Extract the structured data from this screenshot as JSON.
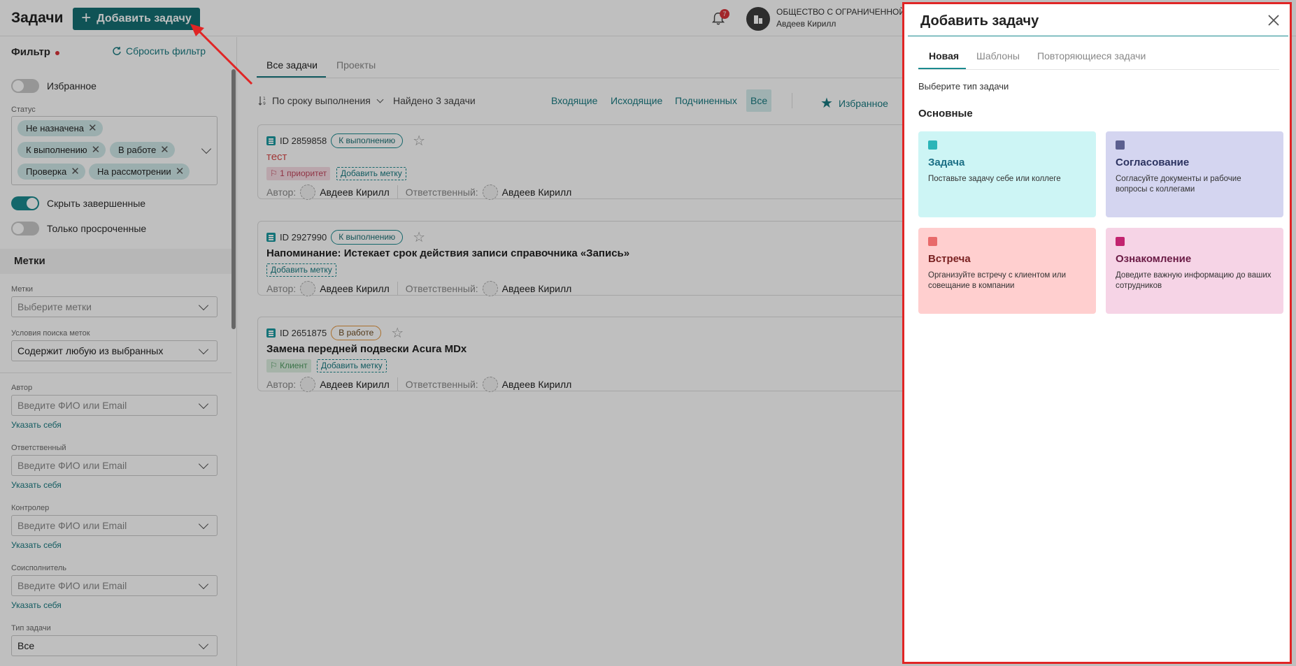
{
  "header": {
    "page_title": "Задачи",
    "add_button_label": "Добавить задачу",
    "notifications_count": "7",
    "org_name": "ОБЩЕСТВО С ОГРАНИЧЕННОЙ ОТ",
    "user_name": "Авдеев Кирилл"
  },
  "sidebar": {
    "filter_title": "Фильтр",
    "reset_filter": "Сбросить фильтр",
    "favorites_toggle": "Избранное",
    "status_label": "Статус",
    "status_chips": [
      "Не назначена",
      "К выполнению",
      "В работе",
      "Проверка",
      "На рассмотрении"
    ],
    "hide_completed": "Скрыть завершенные",
    "only_overdue": "Только просроченные",
    "tags_section": "Метки",
    "tags_label": "Метки",
    "tags_placeholder": "Выберите метки",
    "tag_search_label": "Условия поиска меток",
    "tag_search_value": "Содержит любую из выбранных",
    "author_label": "Автор",
    "author_placeholder": "Введите ФИО или Email",
    "responsible_label": "Ответственный",
    "responsible_placeholder": "Введите ФИО или Email",
    "controller_label": "Контролер",
    "controller_placeholder": "Введите ФИО или Email",
    "coexecutor_label": "Соисполнитель",
    "coexecutor_placeholder": "Введите ФИО или Email",
    "set_me_link": "Указать себя",
    "task_type_label": "Тип задачи",
    "task_type_value": "Все"
  },
  "main": {
    "tabs": [
      "Все задачи",
      "Проекты"
    ],
    "sort_label": "По сроку выполнения",
    "found_text": "Найдено 3 задачи",
    "segments": [
      "Входящие",
      "Исходящие",
      "Подчиненных",
      "Все"
    ],
    "favorites_label": "Избранное",
    "author_prefix": "Автор:",
    "responsible_prefix": "Ответственный:",
    "add_tag_label": "Добавить метку",
    "tasks": [
      {
        "id": "ID 2859858",
        "status": "К выполнению",
        "title": "тест",
        "tag": "1 приоритет",
        "author": "Авдеев Кирилл",
        "responsible": "Авдеев Кирилл"
      },
      {
        "id": "ID 2927990",
        "status": "К выполнению",
        "title": "Напоминание: Истекает срок действия записи справочника «Запись»",
        "author": "Авдеев Кирилл",
        "responsible": "Авдеев Кирилл"
      },
      {
        "id": "ID 2651875",
        "status": "В работе",
        "title": "Замена передней подвески Acura MDx",
        "tag": "Клиент",
        "author": "Авдеев Кирилл",
        "responsible": "Авдеев Кирилл"
      }
    ]
  },
  "panel": {
    "title": "Добавить задачу",
    "tabs": [
      "Новая",
      "Шаблоны",
      "Повторяющиеся задачи"
    ],
    "subtitle": "Выберите тип задачи",
    "section": "Основные",
    "types": [
      {
        "name": "Задача",
        "desc": "Поставьте задачу себе или коллеге",
        "bg": "#cdf5f5",
        "color": "#1b6f85",
        "icon_bg": "#2bb5b8",
        "icon": "list-icon"
      },
      {
        "name": "Согласование",
        "desc": "Согласуйте документы и рабочие вопросы с коллегами",
        "bg": "#d4d5f0",
        "color": "#2c3360",
        "icon_bg": "#5b5f8f",
        "icon": "approve-icon"
      },
      {
        "name": "Встреча",
        "desc": "Организуйте встречу с клиентом или совещание в компании",
        "bg": "#ffcfcf",
        "color": "#7a2222",
        "icon_bg": "#e86a6a",
        "icon": "clock-icon"
      },
      {
        "name": "Ознакомление",
        "desc": "Доведите важную информацию до ваших сотрудников",
        "bg": "#f6d4e6",
        "color": "#6a1b45",
        "icon_bg": "#c2246f",
        "icon": "eye-icon"
      }
    ]
  },
  "colors": {
    "accent": "#146f73",
    "highlight": "#e02525"
  }
}
